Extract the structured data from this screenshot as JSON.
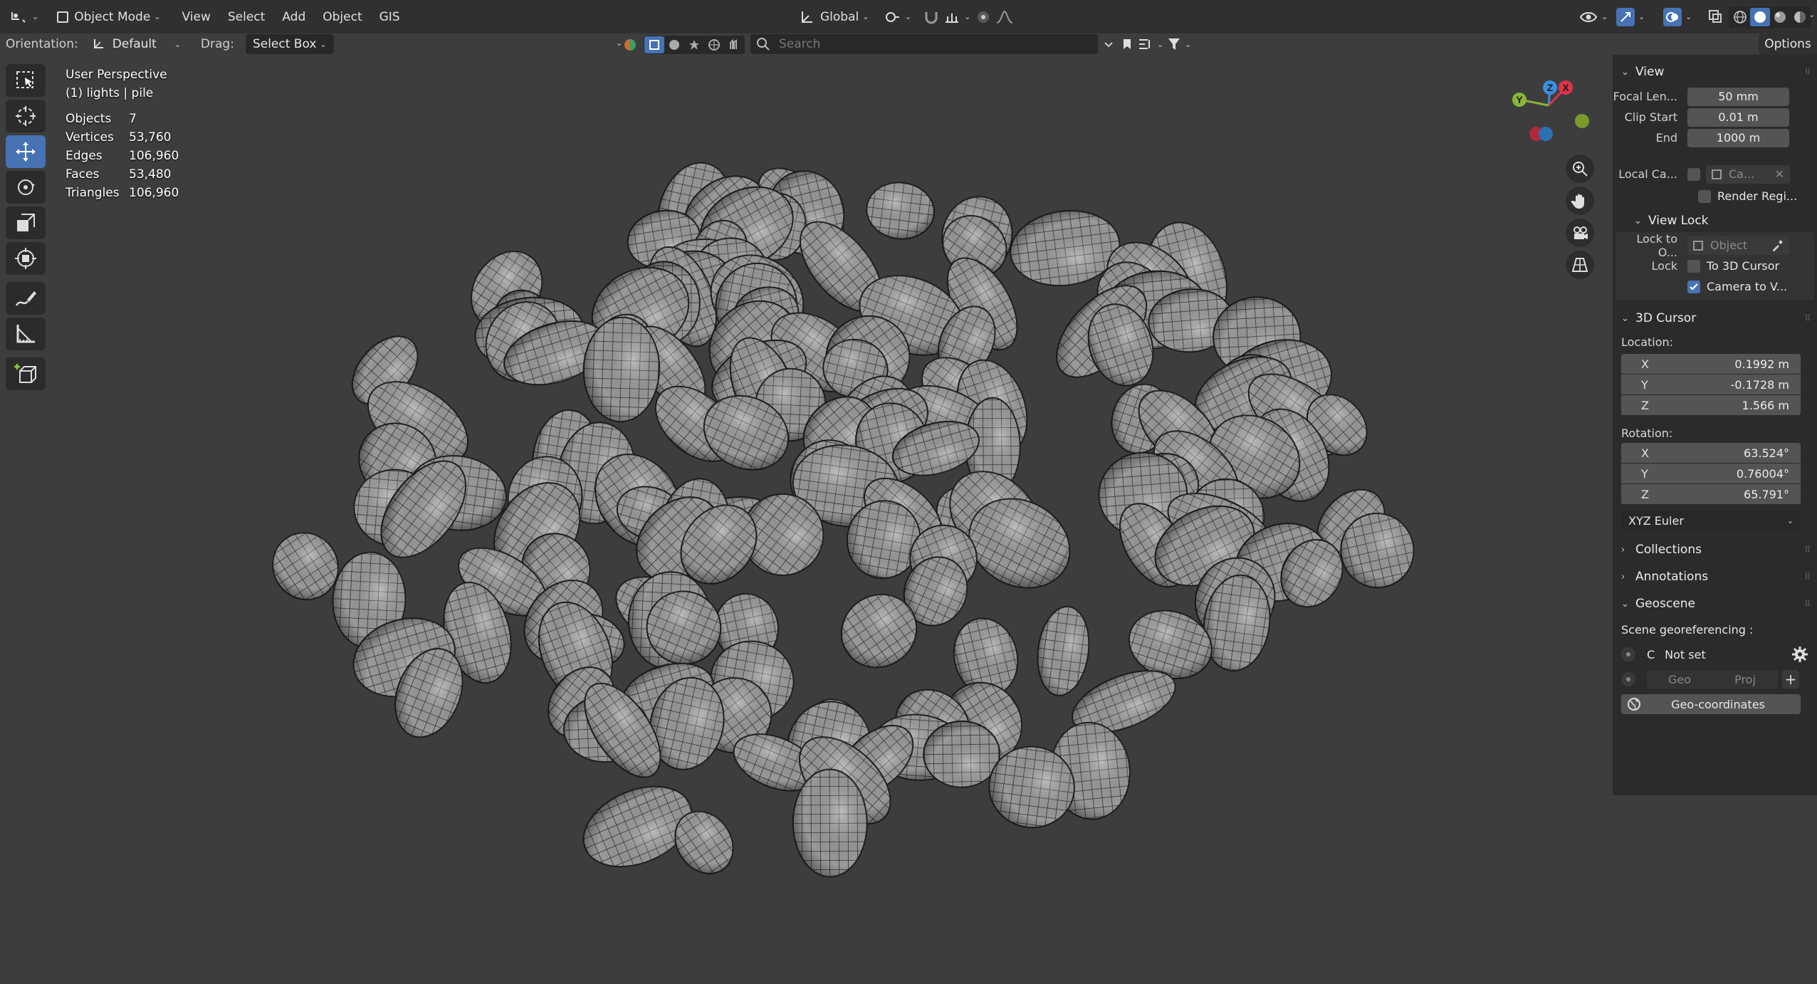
{
  "header": {
    "mode": "Object Mode",
    "menus": [
      "View",
      "Select",
      "Add",
      "Object",
      "GIS"
    ],
    "transform_orientation": "Global"
  },
  "toolrow": {
    "orientation_label": "Orientation:",
    "orientation_value": "Default",
    "drag_label": "Drag:",
    "drag_value": "Select Box",
    "search_placeholder": "Search",
    "options": "Options"
  },
  "viewport": {
    "perspective": "User Perspective",
    "context": "(1) lights | pile",
    "stats": [
      {
        "label": "Objects",
        "value": "7"
      },
      {
        "label": "Vertices",
        "value": "53,760"
      },
      {
        "label": "Edges",
        "value": "106,960"
      },
      {
        "label": "Faces",
        "value": "53,480"
      },
      {
        "label": "Triangles",
        "value": "106,960"
      }
    ],
    "gizmo": {
      "x": "X",
      "y": "Y",
      "z": "Z"
    }
  },
  "sidebar": {
    "view": {
      "title": "View",
      "focal_label": "Focal Len...",
      "focal_value": "50 mm",
      "clip_start_label": "Clip Start",
      "clip_start_value": "0.01 m",
      "end_label": "End",
      "end_value": "1000 m",
      "local_camera_label": "Local Ca...",
      "local_camera_value": "Ca...",
      "render_region": "Render Regi..."
    },
    "view_lock": {
      "title": "View Lock",
      "lock_to_label": "Lock to O...",
      "lock_to_value": "Object",
      "lock_label": "Lock",
      "to_cursor": "To 3D Cursor",
      "camera_to_view": "Camera to V..."
    },
    "cursor": {
      "title": "3D Cursor",
      "location_label": "Location:",
      "loc_x": "0.1992 m",
      "loc_y": "-0.1728 m",
      "loc_z": "1.566 m",
      "rotation_label": "Rotation:",
      "rot_x": "63.524°",
      "rot_y": "0.76004°",
      "rot_z": "65.791°",
      "rot_mode": "XYZ Euler",
      "axis_x": "X",
      "axis_y": "Y",
      "axis_z": "Z"
    },
    "collections": "Collections",
    "annotations": "Annotations",
    "geoscene": {
      "title": "Geoscene",
      "georef_label": "Scene georeferencing :",
      "crs_letter": "C",
      "crs_value": "Not set",
      "geo": "Geo",
      "proj": "Proj",
      "geo_coords": "Geo-coordinates"
    }
  },
  "colors": {
    "accent": "#4772b3",
    "axis_x": "#e0344a",
    "axis_y": "#8bb43b",
    "axis_z": "#3a8fe0"
  }
}
